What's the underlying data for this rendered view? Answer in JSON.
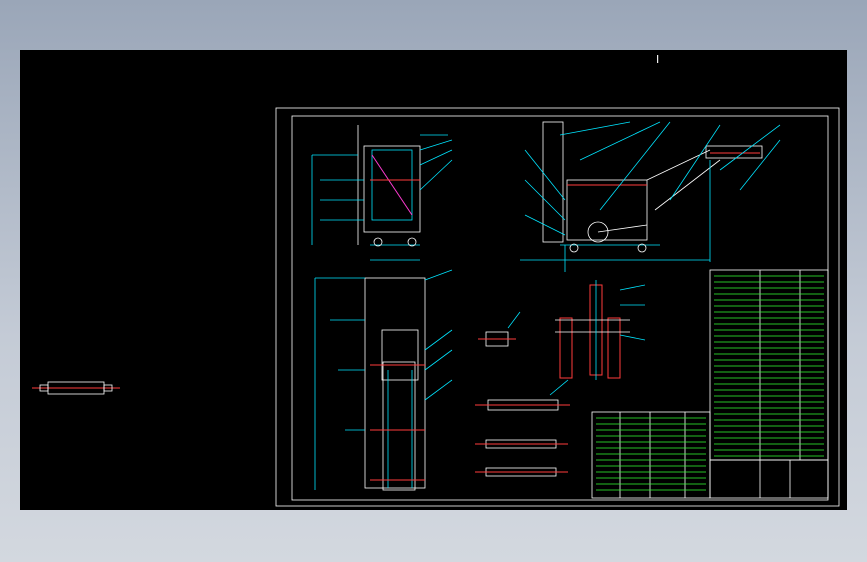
{
  "canvas": {
    "background": "#000000"
  },
  "colors": {
    "frame": "#ffffff",
    "geometry": "#00e5ff",
    "highlight": "#ff3b3b",
    "accent": "#ff3bd0",
    "table_text": "#33ff33"
  },
  "labels": {
    "top_marker": "I"
  }
}
